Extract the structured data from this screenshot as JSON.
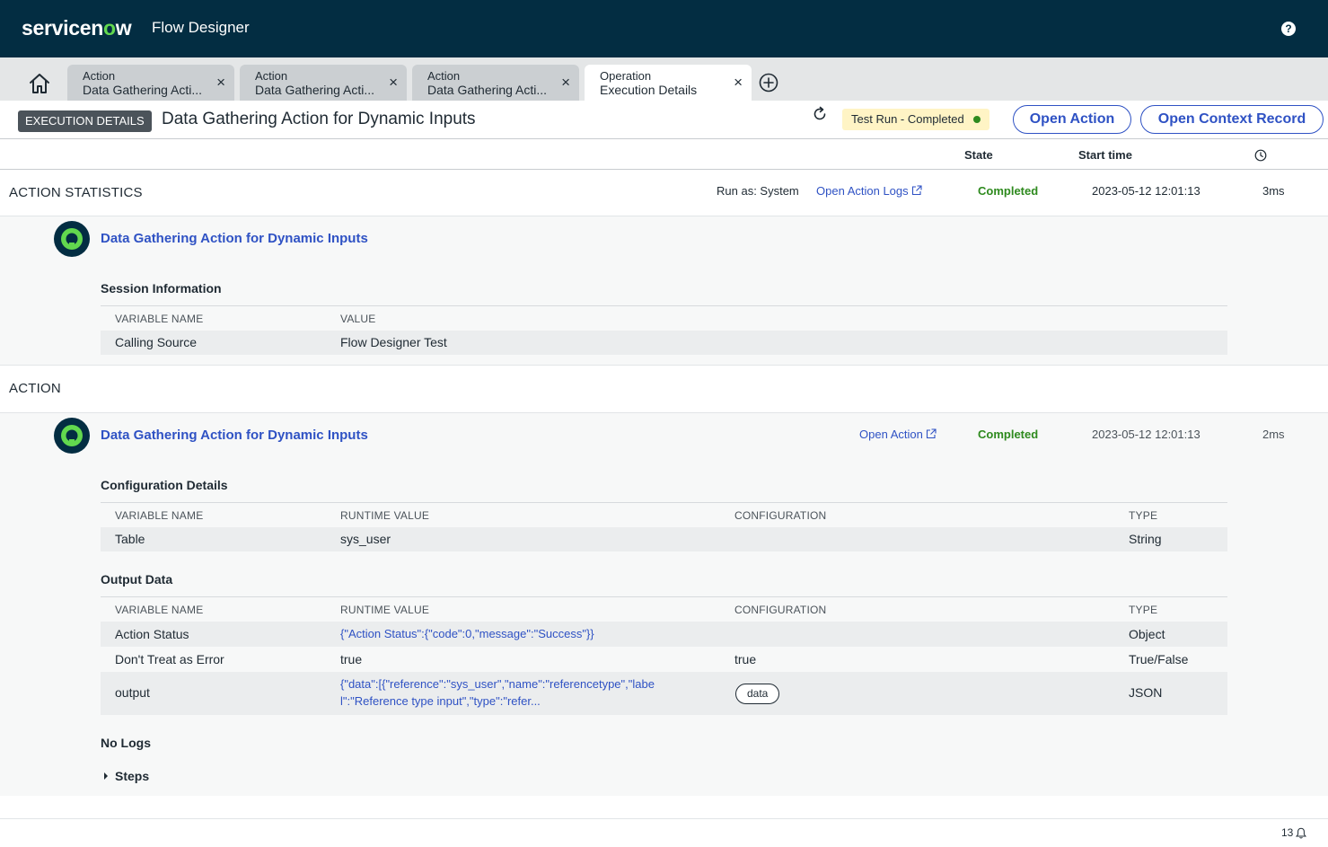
{
  "header": {
    "logo_prefix": "servicen",
    "logo_accent": "o",
    "logo_suffix": "w",
    "app_title": "Flow Designer",
    "help_label": "?"
  },
  "tabs": [
    {
      "type": "Action",
      "name": "Data Gathering Acti...",
      "close": "×"
    },
    {
      "type": "Action",
      "name": "Data Gathering Acti...",
      "close": "×"
    },
    {
      "type": "Action",
      "name": "Data Gathering Acti...",
      "close": "×"
    },
    {
      "type": "Operation",
      "name": "Execution Details",
      "close": "×"
    }
  ],
  "toolbar": {
    "badge": "EXECUTION DETAILS",
    "title": "Data Gathering Action for Dynamic Inputs",
    "status": "Test Run - Completed",
    "open_action": "Open Action",
    "open_context": "Open Context Record"
  },
  "columns": {
    "state": "State",
    "start_time": "Start time"
  },
  "statistics": {
    "title": "ACTION STATISTICS",
    "run_as": "Run as: System",
    "open_logs": "Open Action Logs",
    "state": "Completed",
    "start_time": "2023-05-12 12:01:13",
    "duration": "3ms",
    "action_name": "Data Gathering Action for Dynamic Inputs",
    "session_title": "Session Information",
    "session_headers": [
      "VARIABLE NAME",
      "VALUE"
    ],
    "session_rows": [
      {
        "name": "Calling Source",
        "value": "Flow Designer Test"
      }
    ]
  },
  "action": {
    "title": "ACTION",
    "action_name": "Data Gathering Action for Dynamic Inputs",
    "open_action": "Open Action",
    "state": "Completed",
    "start_time": "2023-05-12 12:01:13",
    "duration": "2ms",
    "config_title": "Configuration Details",
    "headers": [
      "VARIABLE NAME",
      "RUNTIME VALUE",
      "CONFIGURATION",
      "TYPE"
    ],
    "config_rows": [
      {
        "name": "Table",
        "runtime": "sys_user",
        "config": "",
        "type": "String"
      }
    ],
    "output_title": "Output Data",
    "output_rows": [
      {
        "name": "Action Status",
        "runtime": "{\"Action Status\":{\"code\":0,\"message\":\"Success\"}}",
        "config": "",
        "type": "Object"
      },
      {
        "name": "Don't Treat as Error",
        "runtime": "true",
        "config": "true",
        "type": "True/False"
      },
      {
        "name": "output",
        "runtime_line1": "{\"data\":[{\"reference\":\"sys_user\",\"name\":\"referencetype\",\"labe",
        "runtime_line2": "l\":\"Reference type input\",\"type\":\"refer...",
        "config_pill": "data",
        "type": "JSON"
      }
    ],
    "no_logs": "No Logs",
    "steps": "Steps"
  },
  "footer": {
    "notification_count": "13"
  },
  "colors": {
    "header_bg": "#032d42",
    "brand_green": "#62d84e",
    "link_blue": "#2f52c4",
    "success_green": "#2e8a1e"
  }
}
